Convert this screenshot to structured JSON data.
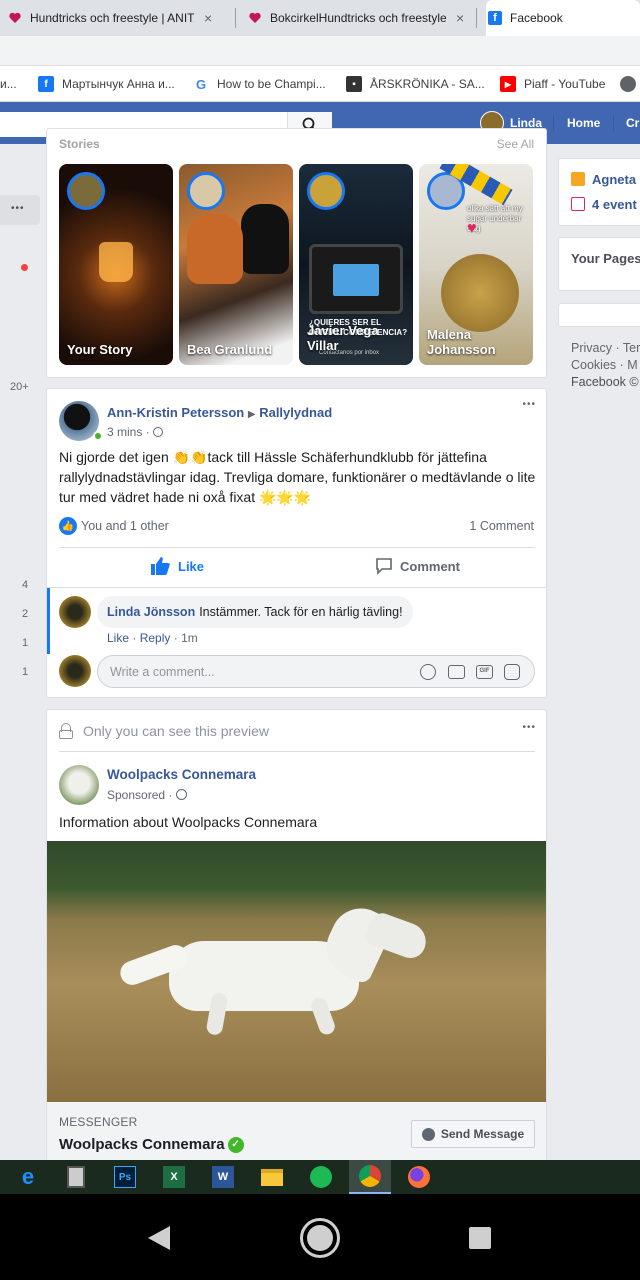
{
  "browser": {
    "tabs": [
      {
        "title": "Hundtricks och freestyle | ANITA/",
        "close": "×"
      },
      {
        "title": "BokcirkelHundtricks och freestyle",
        "close": "×"
      },
      {
        "title": "Facebook"
      }
    ],
    "bookmarks": [
      {
        "label": "и..."
      },
      {
        "label": "Мартынчук Анна и..."
      },
      {
        "label": "How to be Champi..."
      },
      {
        "label": "ÅRSKRÖNIKA - SA..."
      },
      {
        "label": "Piaff - YouTube"
      }
    ]
  },
  "fb_nav": {
    "user_name": "Linda",
    "home": "Home",
    "create_partial": "Cr"
  },
  "left_rail": {
    "more": "•••",
    "badge_20": "20+",
    "count_4": "4",
    "count_2": "2",
    "count_1a": "1",
    "count_1b": "1"
  },
  "stories": {
    "header_partial": "Stories",
    "see_all_partial": "See All",
    "items": [
      {
        "name": "Your Story"
      },
      {
        "name": "Bea Granlund"
      },
      {
        "name": "Javier Vega Villar"
      },
      {
        "name": "Malena Johansson"
      }
    ],
    "overlay_texts": {
      "quieres": "¿QUIERES SER EL OFICIAL COMPETENCIA?",
      "contactanos": "Contactanos por inbox",
      "malena_caption": "olika sätt att my sugar underbar dag"
    }
  },
  "post": {
    "author": "Ann-Kristin Petersson",
    "arrow": "▶",
    "group": "Rallylydnad",
    "time": "3 mins",
    "separator": "·",
    "more": "•••",
    "text": "Ni gjorde det igen 👏👏tack till Hässle Schäferhundklubb för jättefina rallylydnadstävlingar idag. Trevliga domare, funktionärer o medtävlande o lite tur med vädret hade ni oxå fixat 🌟🌟🌟",
    "reactions": "You and 1 other",
    "comments_count": "1 Comment",
    "like": "Like",
    "comment": "Comment",
    "reply": {
      "author": "Linda Jönsson",
      "text": "Instämmer. Tack för en härlig tävling!",
      "like": "Like",
      "dot": "·",
      "reply": "Reply",
      "time": "1m"
    },
    "write_placeholder": "Write a comment..."
  },
  "ad": {
    "privacy_note": "Only you can see this preview",
    "more": "•••",
    "page_name": "Woolpacks Connemara",
    "sponsored": "Sponsored",
    "dot": "·",
    "body": "Information about Woolpacks Connemara",
    "messenger_label": "MESSENGER",
    "cta_title": "Woolpacks Connemara",
    "cta_button": "Send Message"
  },
  "right_rail": {
    "birthday_partial": "Agneta",
    "events_partial": "4 event",
    "your_pages_partial": "Your Pages",
    "footer": {
      "line1": "Privacy · Ter",
      "line2": "Cookies · M",
      "line3": "Facebook ©"
    }
  },
  "colors": {
    "fb_blue": "#4267b2",
    "link_blue": "#385898",
    "like_blue": "#1877f2",
    "page_bg": "#e9ebee"
  }
}
